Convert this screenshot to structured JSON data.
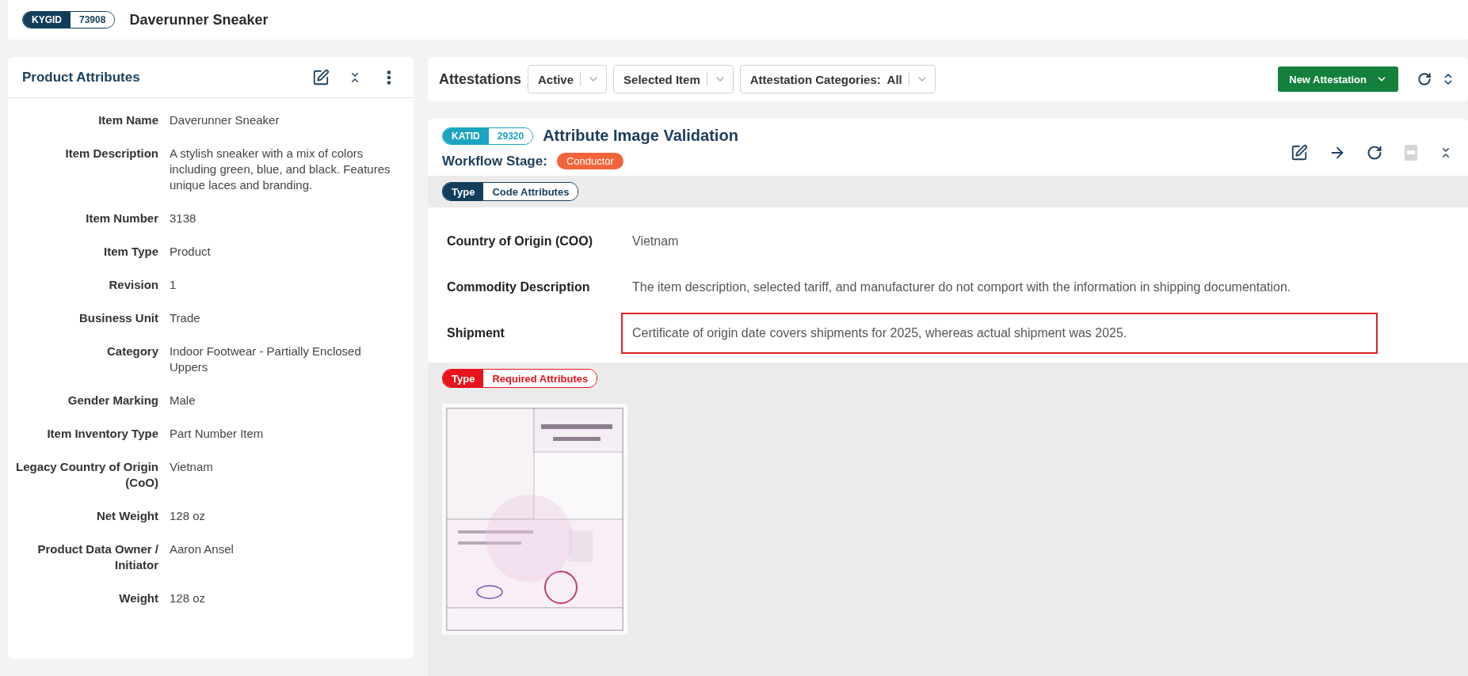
{
  "header": {
    "id_label": "KYGID",
    "id_value": "73908",
    "title": "Daverunner Sneaker"
  },
  "product_attributes": {
    "title": "Product Attributes",
    "rows": [
      {
        "label": "Item Name",
        "value": "Daverunner Sneaker"
      },
      {
        "label": "Item Description",
        "value": "A stylish sneaker with a mix of colors including green, blue, and black. Features unique laces and branding."
      },
      {
        "label": "Item Number",
        "value": "3138"
      },
      {
        "label": "Item Type",
        "value": "Product"
      },
      {
        "label": "Revision",
        "value": "1"
      },
      {
        "label": "Business Unit",
        "value": "Trade"
      },
      {
        "label": "Category",
        "value": "Indoor Footwear - Partially Enclosed Uppers"
      },
      {
        "label": "Gender Marking",
        "value": "Male"
      },
      {
        "label": "Item Inventory Type",
        "value": "Part Number Item"
      },
      {
        "label": "Legacy Country of Origin (CoO)",
        "value": "Vietnam"
      },
      {
        "label": "Net Weight",
        "value": "128 oz"
      },
      {
        "label": "Product Data Owner / Initiator",
        "value": "Aaron Ansel"
      },
      {
        "label": "Weight",
        "value": "128 oz"
      }
    ]
  },
  "attestations": {
    "title": "Attestations",
    "filters": [
      {
        "label": "Active"
      },
      {
        "label": "Selected Item"
      },
      {
        "label": "Attestation Categories:  All"
      }
    ],
    "new_button": "New Attestation"
  },
  "attestation": {
    "id_label": "KATID",
    "id_value": "29320",
    "title": "Attribute Image Validation",
    "stage_label": "Workflow Stage:",
    "stage": "Conductor",
    "sections": [
      {
        "kind": "fields",
        "type_label": "Type",
        "type_value": "Code Attributes",
        "color": "#123e5c",
        "rows": [
          {
            "label": "Country of Origin (COO)",
            "value": "Vietnam",
            "highlighted": false
          },
          {
            "label": "Commodity Description",
            "value": "The item description, selected tariff, and manufacturer do not comport with the information in shipping documentation.",
            "highlighted": false
          },
          {
            "label": "Shipment",
            "value": "Certificate of origin date covers shipments for 2025, whereas actual shipment was 2025.",
            "highlighted": true
          }
        ]
      },
      {
        "kind": "images",
        "type_label": "Type",
        "type_value": "Required Attributes",
        "color": "#e8141b"
      }
    ]
  }
}
